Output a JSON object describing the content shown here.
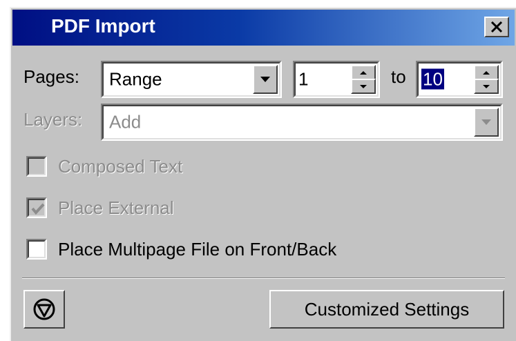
{
  "window": {
    "title": "PDF Import"
  },
  "pages": {
    "label": "Pages:",
    "mode_value": "Range",
    "from_value": "1",
    "to_label": "to",
    "to_value": "10"
  },
  "layers": {
    "label": "Layers:",
    "value": "Add"
  },
  "options": {
    "composed_text": {
      "label": "Composed Text",
      "checked": false,
      "enabled": false
    },
    "place_external": {
      "label": "Place External",
      "checked": true,
      "enabled": false
    },
    "place_multipage": {
      "label": "Place Multipage File on Front/Back",
      "checked": false,
      "enabled": true
    }
  },
  "footer": {
    "customized_settings_label": "Customized Settings"
  },
  "icons": {
    "close": "close-icon",
    "help": "triangle-circle-icon",
    "dropdown": "chevron-down-icon",
    "spin_up": "spin-up-icon",
    "spin_down": "spin-down-icon",
    "check": "checkmark-icon"
  },
  "colors": {
    "title_gradient_start": "#000f83",
    "title_gradient_end": "#6fa6e6",
    "dialog_bg": "#c3c3c3",
    "selection": "#000080",
    "disabled_text": "#8c8c8c"
  }
}
